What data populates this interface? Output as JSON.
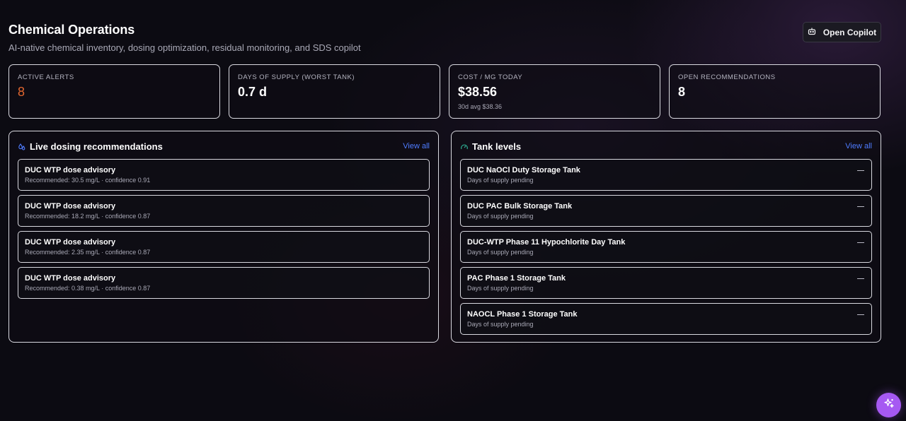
{
  "header": {
    "title": "Chemical Operations",
    "subtitle": "AI-native chemical inventory, dosing optimization, residual monitoring, and SDS copilot"
  },
  "actions": {
    "open_copilot_label": "Open Copilot",
    "open_copilot_icon": "bot-icon",
    "fab_icon": "sparkles-icon"
  },
  "stats": [
    {
      "label": "ACTIVE ALERTS",
      "value": "8",
      "sub": ""
    },
    {
      "label": "DAYS OF SUPPLY (WORST TANK)",
      "value": "0.7 d",
      "sub": ""
    },
    {
      "label": "COST / MG TODAY",
      "value": "$38.56",
      "sub": "30d avg $38.36"
    },
    {
      "label": "OPEN RECOMMENDATIONS",
      "value": "8",
      "sub": ""
    }
  ],
  "dosing": {
    "title": "Live dosing recommendations",
    "icon": "droplets-icon",
    "view_all": "View all",
    "items": [
      {
        "title": "DUC WTP dose advisory",
        "sub": "Recommended: 30.5 mg/L · confidence 0.91"
      },
      {
        "title": "DUC WTP dose advisory",
        "sub": "Recommended: 18.2 mg/L · confidence 0.87"
      },
      {
        "title": "DUC WTP dose advisory",
        "sub": "Recommended: 2.35 mg/L · confidence 0.87"
      },
      {
        "title": "DUC WTP dose advisory",
        "sub": "Recommended: 0.38 mg/L · confidence 0.87"
      }
    ]
  },
  "tanks": {
    "title": "Tank levels",
    "icon": "gauge-icon",
    "view_all": "View all",
    "items": [
      {
        "title": "DUC NaOCl Duty Storage Tank",
        "sub": "Days of supply pending",
        "level": "—"
      },
      {
        "title": "DUC PAC Bulk Storage Tank",
        "sub": "Days of supply pending",
        "level": "—"
      },
      {
        "title": "DUC-WTP Phase 11 Hypochlorite Day Tank",
        "sub": "Days of supply pending",
        "level": "—"
      },
      {
        "title": "PAC Phase 1 Storage Tank",
        "sub": "Days of supply pending",
        "level": "—"
      },
      {
        "title": "NAOCL Phase 1 Storage Tank",
        "sub": "Days of supply pending",
        "level": "—"
      }
    ]
  },
  "colors": {
    "alert_value": "#e0662f",
    "link": "#4e7cff",
    "fab": "#a659f2",
    "dosing_icon": "#4e7cff",
    "tank_icon": "#2fb89a"
  }
}
